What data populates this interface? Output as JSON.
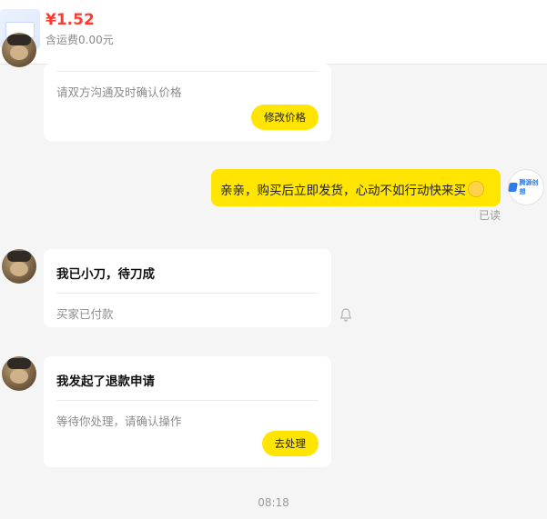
{
  "product": {
    "price": "¥1.52",
    "shipping": "含运费0.00元"
  },
  "messages": {
    "card_price_change": {
      "subtitle": "请双方沟通及时确认价格",
      "button_label": "修改价格"
    },
    "seller_message": {
      "text": "亲亲，购买后立即发货，心动不如行动快来买",
      "read_status": "已读",
      "emoji_icon": "smile-emoji-icon",
      "avatar_logo_text": "腾源创想"
    },
    "card_bargain": {
      "title": "我已小刀，待刀成",
      "subtitle": "买家已付款"
    },
    "card_refund": {
      "title": "我发起了退款申请",
      "subtitle": "等待你处理，请确认操作",
      "button_label": "去处理"
    },
    "timestamp": "08:18"
  },
  "colors": {
    "accent_yellow": "#ffe500",
    "price_red": "#ff3b30",
    "background": "#f5f5f5"
  }
}
